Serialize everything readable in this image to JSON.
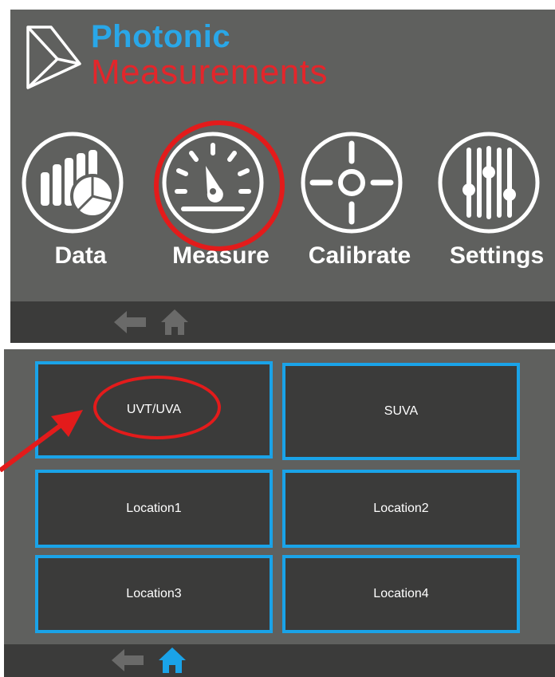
{
  "brand": {
    "name_line1": "Photonic",
    "name_line2": "Measurements",
    "color_primary": "#29a7e8",
    "color_secondary": "#e3262b"
  },
  "main_menu": {
    "items": [
      {
        "label": "Data",
        "icon": "data-chart-icon"
      },
      {
        "label": "Measure",
        "icon": "gauge-icon",
        "highlighted": true
      },
      {
        "label": "Calibrate",
        "icon": "crosshair-icon"
      },
      {
        "label": "Settings",
        "icon": "sliders-icon"
      }
    ]
  },
  "measure_menu": {
    "tiles": [
      {
        "label": "UVT/UVA",
        "highlighted": true
      },
      {
        "label": "SUVA"
      },
      {
        "label": "Location1"
      },
      {
        "label": "Location2"
      },
      {
        "label": "Location3"
      },
      {
        "label": "Location4"
      }
    ]
  },
  "nav": {
    "back_icon": "back-arrow-icon",
    "home_icon": "home-icon",
    "inactive_color": "#6a6a69",
    "active_color": "#1aa3e8"
  },
  "annotation_color": "#e31b1b"
}
